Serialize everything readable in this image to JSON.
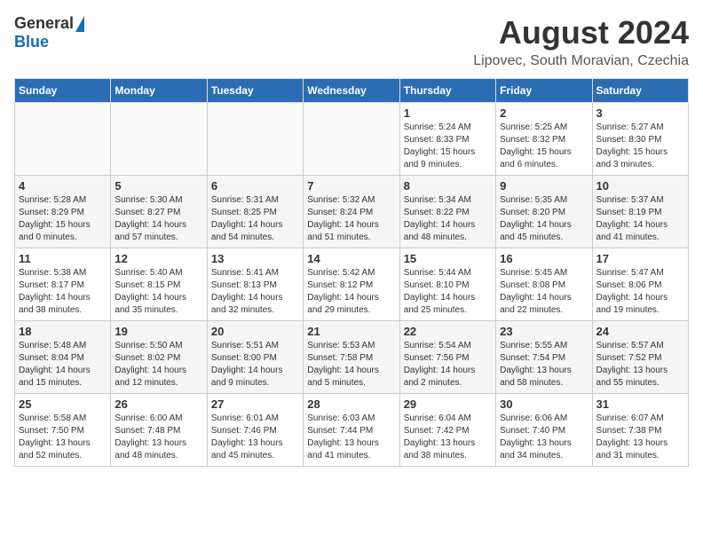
{
  "header": {
    "logo_general": "General",
    "logo_blue": "Blue",
    "month_year": "August 2024",
    "location": "Lipovec, South Moravian, Czechia"
  },
  "calendar": {
    "days_of_week": [
      "Sunday",
      "Monday",
      "Tuesday",
      "Wednesday",
      "Thursday",
      "Friday",
      "Saturday"
    ],
    "weeks": [
      {
        "days": [
          {
            "date": "",
            "info": ""
          },
          {
            "date": "",
            "info": ""
          },
          {
            "date": "",
            "info": ""
          },
          {
            "date": "",
            "info": ""
          },
          {
            "date": "1",
            "info": "Sunrise: 5:24 AM\nSunset: 8:33 PM\nDaylight: 15 hours\nand 9 minutes."
          },
          {
            "date": "2",
            "info": "Sunrise: 5:25 AM\nSunset: 8:32 PM\nDaylight: 15 hours\nand 6 minutes."
          },
          {
            "date": "3",
            "info": "Sunrise: 5:27 AM\nSunset: 8:30 PM\nDaylight: 15 hours\nand 3 minutes."
          }
        ]
      },
      {
        "days": [
          {
            "date": "4",
            "info": "Sunrise: 5:28 AM\nSunset: 8:29 PM\nDaylight: 15 hours\nand 0 minutes."
          },
          {
            "date": "5",
            "info": "Sunrise: 5:30 AM\nSunset: 8:27 PM\nDaylight: 14 hours\nand 57 minutes."
          },
          {
            "date": "6",
            "info": "Sunrise: 5:31 AM\nSunset: 8:25 PM\nDaylight: 14 hours\nand 54 minutes."
          },
          {
            "date": "7",
            "info": "Sunrise: 5:32 AM\nSunset: 8:24 PM\nDaylight: 14 hours\nand 51 minutes."
          },
          {
            "date": "8",
            "info": "Sunrise: 5:34 AM\nSunset: 8:22 PM\nDaylight: 14 hours\nand 48 minutes."
          },
          {
            "date": "9",
            "info": "Sunrise: 5:35 AM\nSunset: 8:20 PM\nDaylight: 14 hours\nand 45 minutes."
          },
          {
            "date": "10",
            "info": "Sunrise: 5:37 AM\nSunset: 8:19 PM\nDaylight: 14 hours\nand 41 minutes."
          }
        ]
      },
      {
        "days": [
          {
            "date": "11",
            "info": "Sunrise: 5:38 AM\nSunset: 8:17 PM\nDaylight: 14 hours\nand 38 minutes."
          },
          {
            "date": "12",
            "info": "Sunrise: 5:40 AM\nSunset: 8:15 PM\nDaylight: 14 hours\nand 35 minutes."
          },
          {
            "date": "13",
            "info": "Sunrise: 5:41 AM\nSunset: 8:13 PM\nDaylight: 14 hours\nand 32 minutes."
          },
          {
            "date": "14",
            "info": "Sunrise: 5:42 AM\nSunset: 8:12 PM\nDaylight: 14 hours\nand 29 minutes."
          },
          {
            "date": "15",
            "info": "Sunrise: 5:44 AM\nSunset: 8:10 PM\nDaylight: 14 hours\nand 25 minutes."
          },
          {
            "date": "16",
            "info": "Sunrise: 5:45 AM\nSunset: 8:08 PM\nDaylight: 14 hours\nand 22 minutes."
          },
          {
            "date": "17",
            "info": "Sunrise: 5:47 AM\nSunset: 8:06 PM\nDaylight: 14 hours\nand 19 minutes."
          }
        ]
      },
      {
        "days": [
          {
            "date": "18",
            "info": "Sunrise: 5:48 AM\nSunset: 8:04 PM\nDaylight: 14 hours\nand 15 minutes."
          },
          {
            "date": "19",
            "info": "Sunrise: 5:50 AM\nSunset: 8:02 PM\nDaylight: 14 hours\nand 12 minutes."
          },
          {
            "date": "20",
            "info": "Sunrise: 5:51 AM\nSunset: 8:00 PM\nDaylight: 14 hours\nand 9 minutes."
          },
          {
            "date": "21",
            "info": "Sunrise: 5:53 AM\nSunset: 7:58 PM\nDaylight: 14 hours\nand 5 minutes."
          },
          {
            "date": "22",
            "info": "Sunrise: 5:54 AM\nSunset: 7:56 PM\nDaylight: 14 hours\nand 2 minutes."
          },
          {
            "date": "23",
            "info": "Sunrise: 5:55 AM\nSunset: 7:54 PM\nDaylight: 13 hours\nand 58 minutes."
          },
          {
            "date": "24",
            "info": "Sunrise: 5:57 AM\nSunset: 7:52 PM\nDaylight: 13 hours\nand 55 minutes."
          }
        ]
      },
      {
        "days": [
          {
            "date": "25",
            "info": "Sunrise: 5:58 AM\nSunset: 7:50 PM\nDaylight: 13 hours\nand 52 minutes."
          },
          {
            "date": "26",
            "info": "Sunrise: 6:00 AM\nSunset: 7:48 PM\nDaylight: 13 hours\nand 48 minutes."
          },
          {
            "date": "27",
            "info": "Sunrise: 6:01 AM\nSunset: 7:46 PM\nDaylight: 13 hours\nand 45 minutes."
          },
          {
            "date": "28",
            "info": "Sunrise: 6:03 AM\nSunset: 7:44 PM\nDaylight: 13 hours\nand 41 minutes."
          },
          {
            "date": "29",
            "info": "Sunrise: 6:04 AM\nSunset: 7:42 PM\nDaylight: 13 hours\nand 38 minutes."
          },
          {
            "date": "30",
            "info": "Sunrise: 6:06 AM\nSunset: 7:40 PM\nDaylight: 13 hours\nand 34 minutes."
          },
          {
            "date": "31",
            "info": "Sunrise: 6:07 AM\nSunset: 7:38 PM\nDaylight: 13 hours\nand 31 minutes."
          }
        ]
      }
    ]
  }
}
